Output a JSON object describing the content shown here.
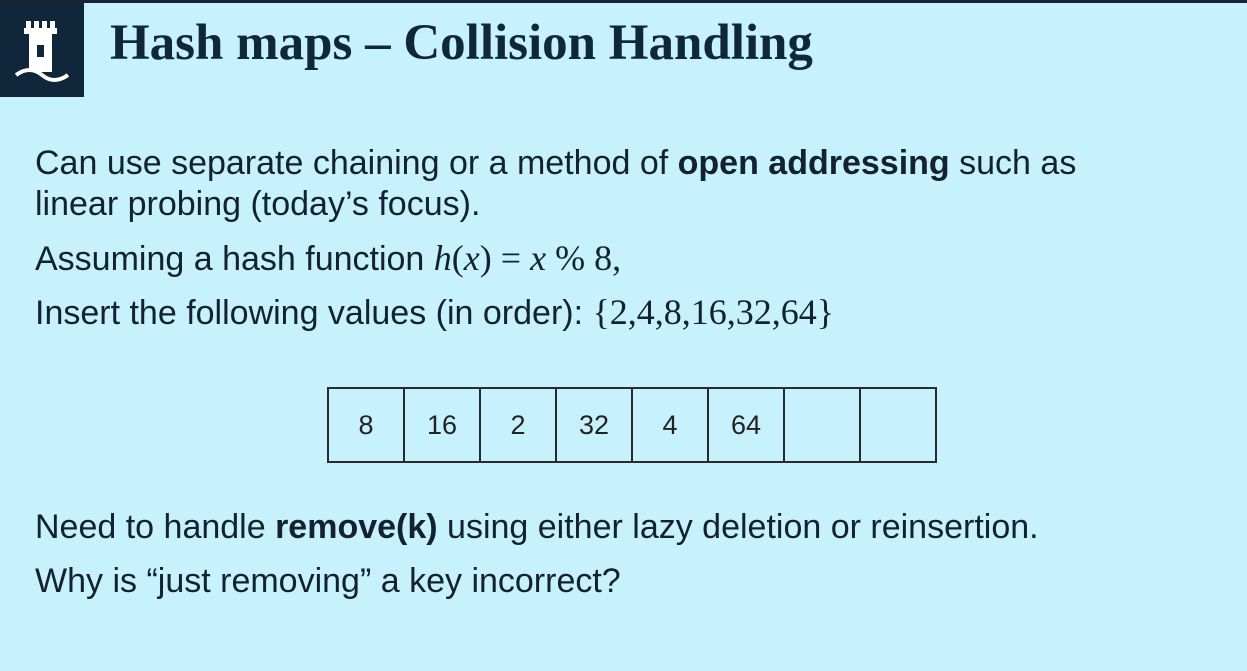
{
  "slide": {
    "title": "Hash maps – Collision Handling",
    "logo": "castle-icon",
    "p1": {
      "text_before": "Can use separate chaining or a method of ",
      "bold": "open addressing",
      "text_after": " such as",
      "line2": "linear probing (today’s focus)."
    },
    "p2": {
      "text": "Assuming a hash function ",
      "math_func": "h",
      "math_paren_open": "(",
      "math_var": "x",
      "math_paren_close": ")",
      "math_eq": " = ",
      "math_var2": "x",
      "math_rest": " % 8,"
    },
    "p3": {
      "text": "Insert the following values (in order): ",
      "math_set": "{2,4,8,16,32,64}"
    },
    "table": {
      "cells": [
        "8",
        "16",
        "2",
        "32",
        "4",
        "64",
        "",
        ""
      ]
    },
    "p4": {
      "text_before": "Need to handle ",
      "bold": "remove(k)",
      "text_after": " using either lazy deletion or reinsertion."
    },
    "p5": {
      "text": "Why is “just removing” a key incorrect?"
    }
  }
}
